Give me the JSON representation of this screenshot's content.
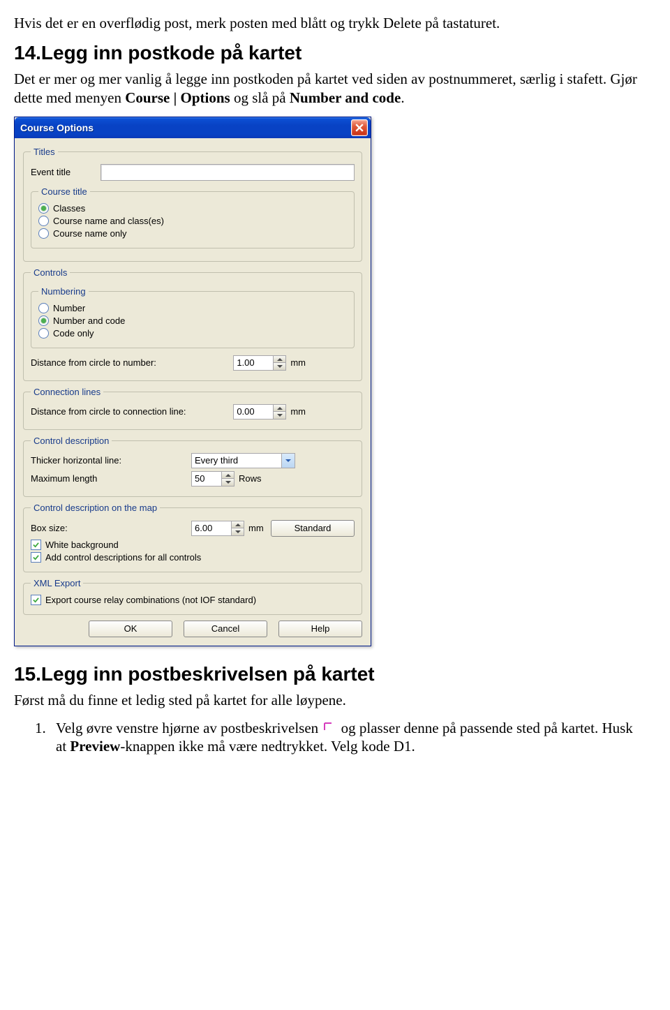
{
  "para1": "Hvis det er en overflødig post, merk posten med blått og trykk Delete på tastaturet.",
  "heading14": "14.Legg inn postkode på kartet",
  "para2a": "Det er mer og mer vanlig å legge inn postkoden på kartet ved siden av postnummeret, særlig i stafett. Gjør dette med menyen ",
  "para2b": "Course | Options",
  "para2c": " og slå på ",
  "para2d": "Number and code",
  "para2e": ".",
  "dialog": {
    "title": "Course Options",
    "titles": {
      "legend": "Titles",
      "event_label": "Event title",
      "event_value": "",
      "course_title_legend": "Course title",
      "opt_classes": "Classes",
      "opt_course_name_classes": "Course name and class(es)",
      "opt_course_name_only": "Course name only"
    },
    "controls": {
      "legend": "Controls",
      "numbering_legend": "Numbering",
      "opt_number": "Number",
      "opt_number_code": "Number and code",
      "opt_code_only": "Code only",
      "dist_label": "Distance from circle to number:",
      "dist_value": "1.00",
      "dist_unit": "mm"
    },
    "conn": {
      "legend": "Connection lines",
      "dist_label": "Distance from circle to connection line:",
      "dist_value": "0.00",
      "dist_unit": "mm"
    },
    "desc": {
      "legend": "Control description",
      "thicker_label": "Thicker horizontal line:",
      "thicker_value": "Every third",
      "maxlen_label": "Maximum length",
      "maxlen_value": "50",
      "maxlen_unit": "Rows"
    },
    "descmap": {
      "legend": "Control description on the map",
      "box_label": "Box size:",
      "box_value": "6.00",
      "box_unit": "mm",
      "standard_btn": "Standard",
      "chk_whitebg": "White background",
      "chk_add_all": "Add control descriptions for all controls"
    },
    "xml": {
      "legend": "XML Export",
      "chk_relay": "Export course relay combinations (not IOF standard)"
    },
    "buttons": {
      "ok": "OK",
      "cancel": "Cancel",
      "help": "Help"
    }
  },
  "heading15": "15.Legg inn postbeskrivelsen på kartet",
  "para3": "Først må du finne et ledig sted på kartet for alle løypene.",
  "list1_num": "1.",
  "list1a": "Velg øvre venstre hjørne av postbeskrivelsen ",
  "list1b": " og plasser denne på passende sted på kartet. Husk at ",
  "list1c": "Preview",
  "list1d": "-knappen ikke må være nedtrykket. Velg kode D1."
}
